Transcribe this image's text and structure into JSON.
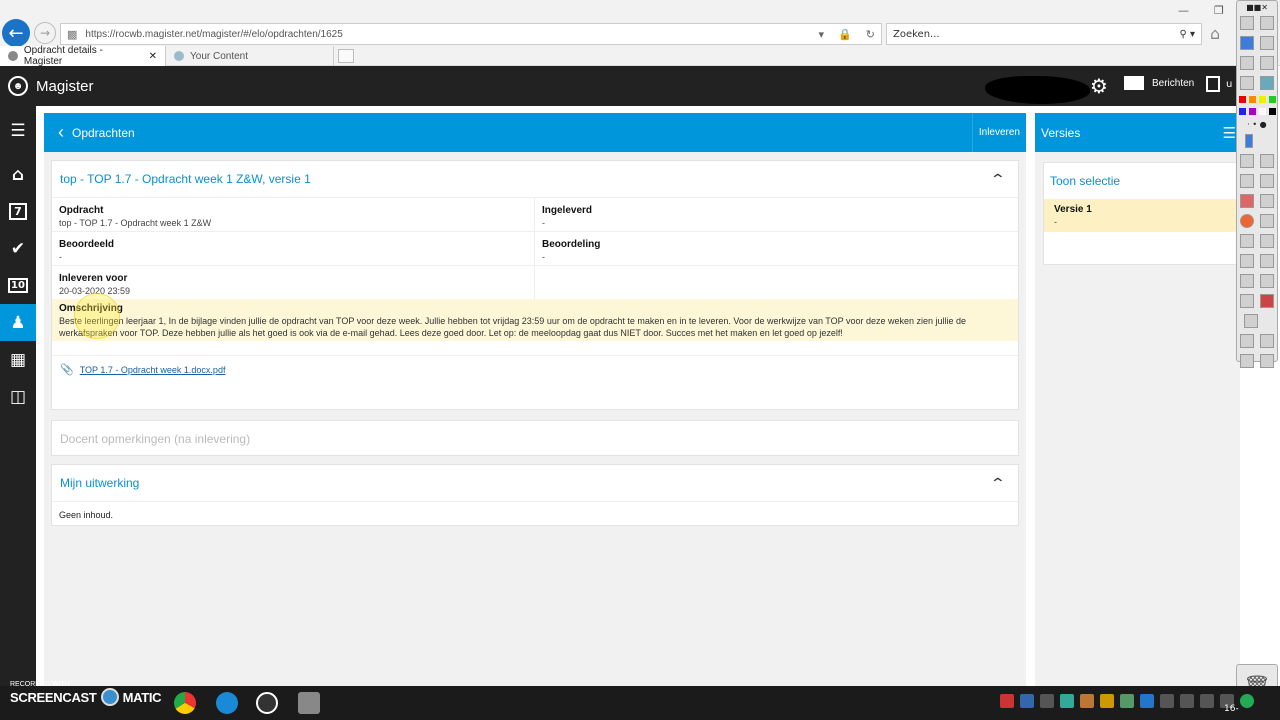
{
  "browser": {
    "url": "https://rocwb.magister.net/magister/#/elo/opdrachten/1625",
    "search_placeholder": "Zoeken...",
    "tabs": [
      {
        "label": "Opdracht details - Magister",
        "active": true
      },
      {
        "label": "Your Content",
        "active": false
      }
    ]
  },
  "app": {
    "title": "Magister",
    "messages_label": "Berichten",
    "logout_label": "u"
  },
  "main": {
    "back_label": "Opdrachten",
    "submit_label": "Inleveren",
    "assignment_card": {
      "title": "top - TOP 1.7 - Opdracht week 1 Z&W, versie 1",
      "fields": {
        "opdracht_label": "Opdracht",
        "opdracht_value": "top - TOP 1.7 - Opdracht week 1 Z&W",
        "ingeleverd_label": "Ingeleverd",
        "ingeleverd_value": "-",
        "beoordeeld_label": "Beoordeeld",
        "beoordeeld_value": "-",
        "beoordeling_label": "Beoordeling",
        "beoordeling_value": "-",
        "deadline_label": "Inleveren voor",
        "deadline_value": "20-03-2020 23:59"
      },
      "description_label": "Omschrijving",
      "description_text": "Beste leerlingen leerjaar 1, In de bijlage vinden jullie de opdracht van TOP voor deze week. Jullie hebben tot vrijdag 23:59 uur om de opdracht te maken en in te leveren. Voor de werkwijze van TOP voor deze weken zien jullie de werkafspraken voor TOP. Deze hebben jullie als het goed is ook via de e-mail gehad. Lees deze goed door. Let op: de meeloopdag gaat dus NIET door. Succes met het maken en let goed op jezelf!",
      "attachment": "TOP 1.7 - Opdracht week 1.docx.pdf"
    },
    "teacher_remarks_placeholder": "Docent opmerkingen (na inlevering)",
    "my_work": {
      "title": "Mijn uitwerking",
      "content": "Geen inhoud."
    }
  },
  "versions_panel": {
    "title": "Versies",
    "toggle_label": "Toon selectie",
    "items": [
      {
        "label": "Versie 1",
        "value": "-"
      }
    ]
  },
  "sidenav_icons": [
    "menu-icon",
    "home-icon",
    "agenda-icon",
    "tasks-icon",
    "grades-icon",
    "studyguide-icon",
    "schedule-add-icon",
    "portfolio-icon"
  ],
  "sidenav_labels": {
    "agenda": "7",
    "grades": "10"
  },
  "watermark": {
    "recorded": "RECORDED WITH",
    "brand_left": "SCREENCAST",
    "brand_right": "MATIC"
  },
  "taskbar": {
    "clock": "16-"
  },
  "colors": {
    "accent": "#0096db",
    "header": "#222222",
    "highlight": "#fdf7d7"
  }
}
